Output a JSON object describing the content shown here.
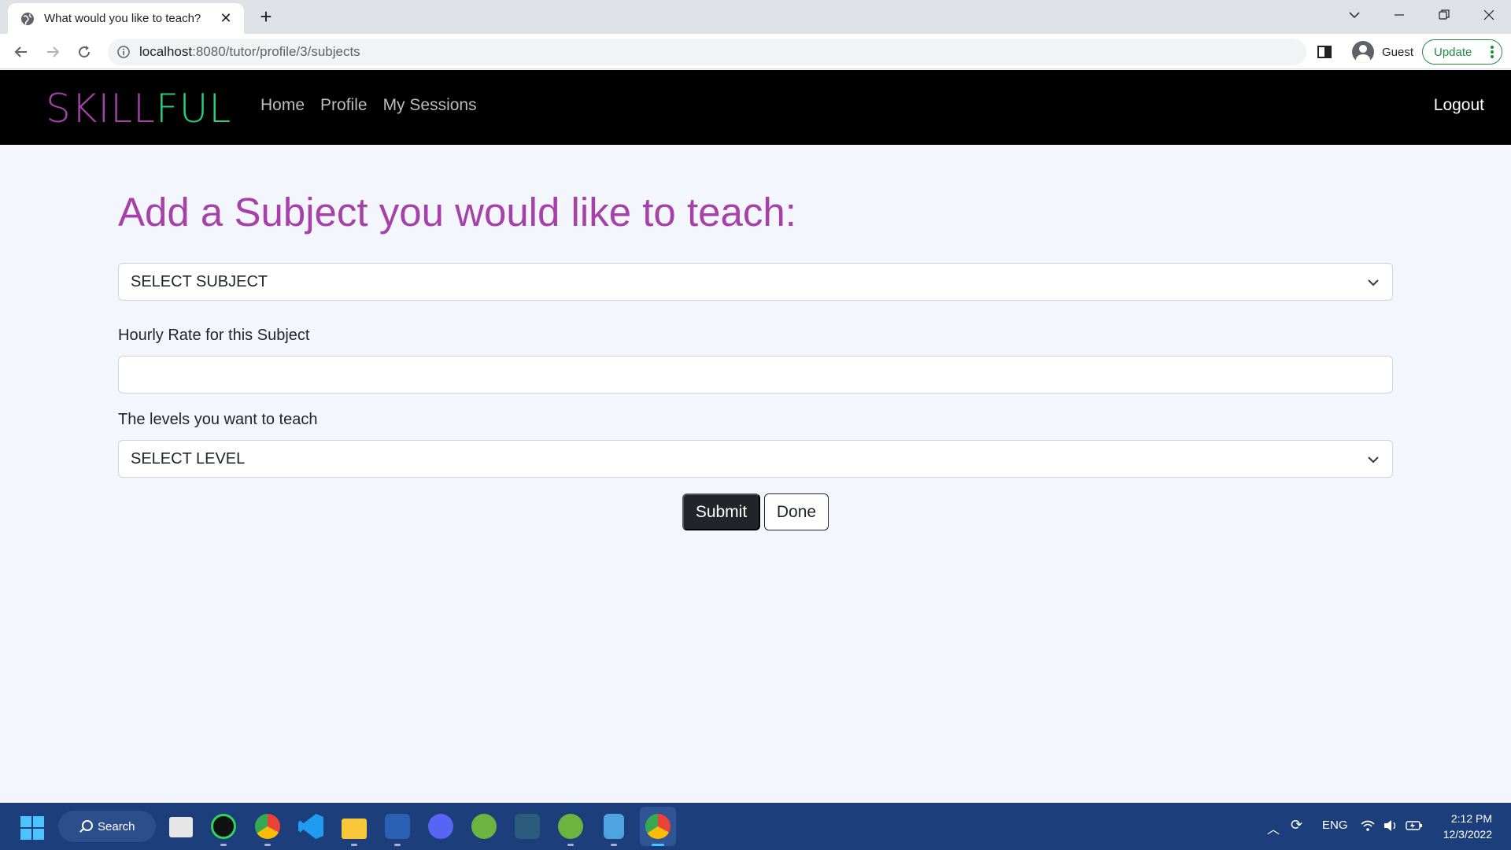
{
  "browser": {
    "tab_title": "What would you like to teach?",
    "url_host": "localhost",
    "url_rest": ":8080/tutor/profile/3/subjects",
    "profile_label": "Guest",
    "update_label": "Update"
  },
  "site": {
    "brand_part1": "SKILL",
    "brand_part2": "FUL",
    "nav": [
      "Home",
      "Profile",
      "My Sessions"
    ],
    "logout": "Logout",
    "colors": {
      "brand_purple": "#a541a8",
      "brand_green": "#27d07a"
    }
  },
  "form": {
    "title": "Add a Subject you would like to teach:",
    "subject_select_value": "SELECT SUBJECT",
    "rate_label": "Hourly Rate for this Subject",
    "rate_value": "",
    "levels_label": "The levels you want to teach",
    "level_select_value": "SELECT LEVEL",
    "submit_label": "Submit",
    "done_label": "Done"
  },
  "taskbar": {
    "search_label": "Search",
    "language": "ENG",
    "time": "2:12 PM",
    "date": "12/3/2022",
    "icons": [
      "start-icon",
      "search-icon",
      "task-view-icon",
      "obs-icon",
      "chrome-canary-icon",
      "vscode-icon",
      "file-explorer-icon",
      "word-icon",
      "discord-icon",
      "spring-tools-icon",
      "mysql-workbench-icon",
      "spring-boot-icon",
      "notepad-icon",
      "chrome-icon"
    ]
  }
}
